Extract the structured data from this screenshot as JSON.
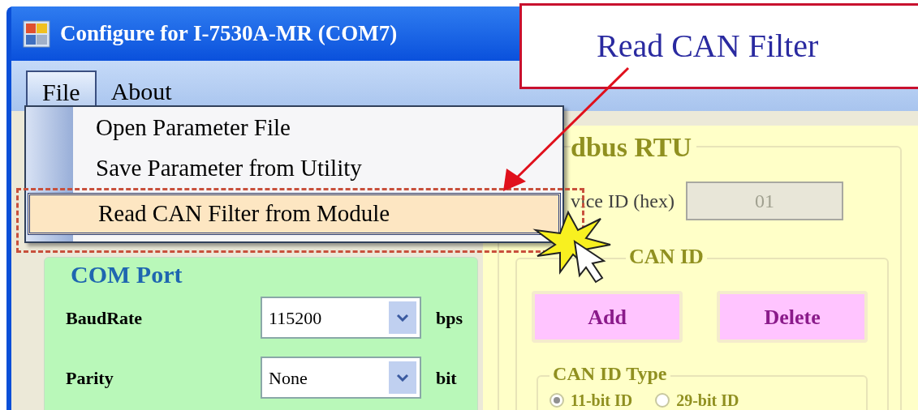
{
  "window": {
    "title": "Configure for I-7530A-MR (COM7)"
  },
  "menu_bar": [
    {
      "label": "File",
      "selected": true
    },
    {
      "label": "About",
      "selected": false
    }
  ],
  "file_menu": [
    {
      "label": "Open Parameter File",
      "selected": false
    },
    {
      "label": "Save Parameter from Utility",
      "selected": false
    },
    {
      "label": "Read CAN Filter from Module",
      "selected": true
    }
  ],
  "com_port": {
    "title": "COM Port",
    "fields": [
      {
        "label": "BaudRate",
        "value": "115200",
        "unit": "bps"
      },
      {
        "label": "Parity",
        "value": "None",
        "unit": "bit"
      }
    ]
  },
  "modbus": {
    "title": "dbus RTU",
    "device_id_label": "vice ID (hex)",
    "device_id_value": "01",
    "device_id_disabled": true
  },
  "can_id": {
    "title": "CAN ID",
    "buttons": [
      "Add",
      "Delete"
    ],
    "type_title": "CAN ID Type",
    "types": [
      {
        "label": "11-bit ID",
        "selected": true
      },
      {
        "label": "29-bit ID",
        "selected": false
      }
    ]
  },
  "annotation": {
    "callout": "Read CAN Filter"
  }
}
